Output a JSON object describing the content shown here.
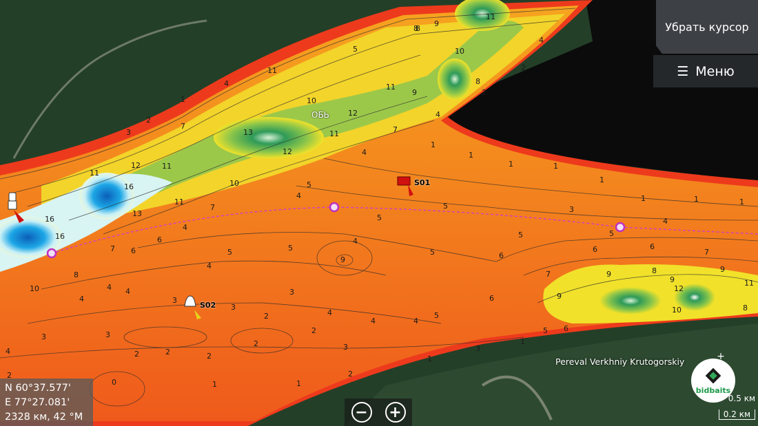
{
  "ui": {
    "remove_cursor_label": "Убрать курсор",
    "menu_label": "Меню",
    "zoom_out": "−",
    "zoom_in": "+"
  },
  "position": {
    "lat": "N  60°37.577'",
    "lon": "E  77°27.081'",
    "dist": "2328 км, 42 °M"
  },
  "labels": {
    "river": "ОБЬ",
    "place": "Pereval Verkhniy Krutogorskiy",
    "wp1": "S01",
    "wp2": "S02"
  },
  "logo": {
    "text": "bidbaits"
  },
  "scale": {
    "zoom": "0.5 км",
    "bar": "0.2 км"
  },
  "depth_labels": [
    "11",
    "9",
    "8",
    "5",
    "4",
    "2",
    "3",
    "10",
    "13",
    "12",
    "7",
    "16",
    "6",
    "1"
  ],
  "colors": {
    "land": "#23402a",
    "shallow": "#f03a1c",
    "mid": "#f6941d",
    "yellow": "#f2e12a",
    "green": "#2f9a5b",
    "deep": "#1e8fd6"
  }
}
